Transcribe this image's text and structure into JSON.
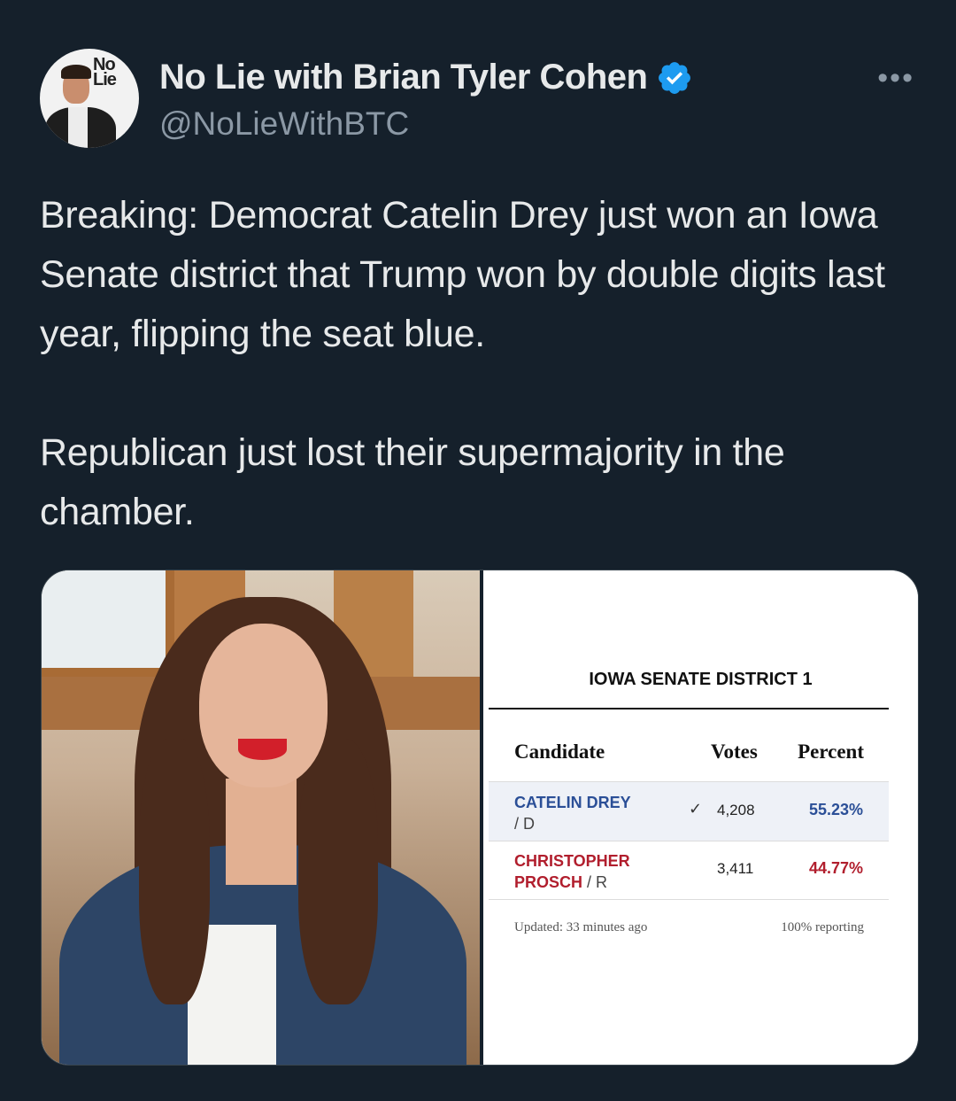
{
  "author": {
    "display_name": "No Lie with Brian Tyler Cohen",
    "handle": "@NoLieWithBTC",
    "avatar_logo": "No Lie",
    "verified_icon": "verified-badge-icon",
    "more_label": "•••"
  },
  "tweet": {
    "paragraph_1": "Breaking: Democrat Catelin Drey just won an Iowa Senate district that Trump won by double digits last year, flipping the seat blue.",
    "paragraph_2": "Republican just lost their supermajority in the chamber."
  },
  "results": {
    "title": "IOWA SENATE DISTRICT 1",
    "headers": {
      "candidate": "Candidate",
      "votes": "Votes",
      "percent": "Percent"
    },
    "rows": [
      {
        "name": "CATELIN DREY",
        "party": "/ D",
        "winner_mark": "✓",
        "votes": "4,208",
        "percent": "55.23%"
      },
      {
        "name": "CHRISTOPHER PROSCH",
        "party": "/ R",
        "winner_mark": "",
        "votes": "3,411",
        "percent": "44.77%"
      }
    ],
    "updated": "Updated: 33 minutes ago",
    "reporting": "100% reporting"
  },
  "colors": {
    "background": "#15202b",
    "verified_blue": "#1d9bf0",
    "democrat_blue": "#2b4f97",
    "republican_red": "#b11e2d"
  }
}
